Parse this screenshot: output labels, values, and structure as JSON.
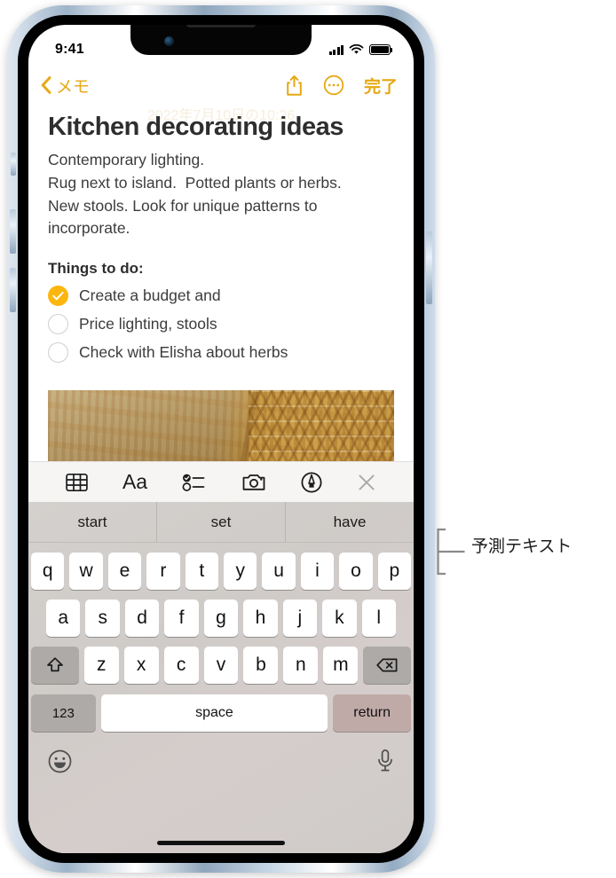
{
  "status_bar": {
    "time": "9:41",
    "cellular_icon": "signal-bars-icon",
    "wifi_icon": "wifi-icon",
    "battery_icon": "battery-full-icon"
  },
  "nav_bar": {
    "back_icon": "chevron-left-icon",
    "back_label": "メモ",
    "share_icon": "share-icon",
    "more_icon": "more-circle-icon",
    "done_label": "完了"
  },
  "note": {
    "date_stamp": "2022年7月10日の10:26",
    "title": "Kitchen decorating ideas",
    "paragraph_lines": [
      "Contemporary lighting.",
      "Rug next to island.  Potted plants or herbs.",
      "New stools. Look for unique patterns to",
      "incorporate."
    ],
    "todo_heading": "Things to do:",
    "todo_items": [
      {
        "label": "Create a budget and",
        "checked": true
      },
      {
        "label": "Price lighting, stools",
        "checked": false
      },
      {
        "label": "Check with Elisha about herbs",
        "checked": false
      }
    ],
    "attachment_name": "photo-attachment"
  },
  "editor_toolbar": {
    "items": [
      {
        "icon": "table-icon",
        "name": "insert-table-button"
      },
      {
        "icon": "text-format-icon",
        "name": "text-format-button",
        "label": "Aa"
      },
      {
        "icon": "checklist-icon",
        "name": "checklist-button"
      },
      {
        "icon": "camera-icon",
        "name": "camera-button"
      },
      {
        "icon": "markup-pen-icon",
        "name": "markup-button"
      },
      {
        "icon": "close-icon",
        "name": "close-toolbar-button"
      }
    ]
  },
  "keyboard": {
    "predictive": [
      "start",
      "set",
      "have"
    ],
    "row1": [
      "q",
      "w",
      "e",
      "r",
      "t",
      "y",
      "u",
      "i",
      "o",
      "p"
    ],
    "row2": [
      "a",
      "s",
      "d",
      "f",
      "g",
      "h",
      "j",
      "k",
      "l"
    ],
    "row3": [
      "z",
      "x",
      "c",
      "v",
      "b",
      "n",
      "m"
    ],
    "shift_icon": "shift-arrow-icon",
    "delete_icon": "delete-backspace-icon",
    "numbers_label": "123",
    "space_label": "space",
    "return_label": "return",
    "emoji_icon": "emoji-smiley-icon",
    "dictation_icon": "microphone-icon"
  },
  "callout": {
    "label": "予測テキスト",
    "bracket_name": "callout-bracket"
  },
  "colors": {
    "accent": "#E6A812",
    "checkbox_checked": "#FCB60E",
    "text_primary": "#2e2e2e",
    "keyboard_bg": "#d2cfcc"
  }
}
